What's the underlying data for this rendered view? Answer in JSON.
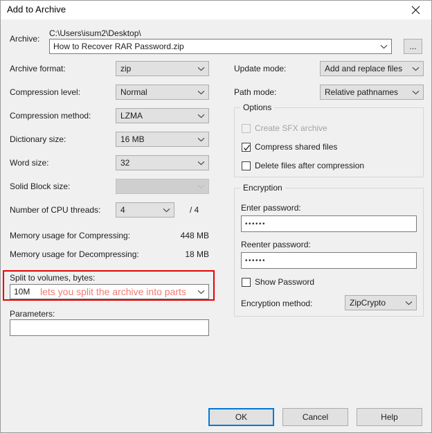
{
  "window": {
    "title": "Add to Archive",
    "close_icon": "close-icon"
  },
  "archive": {
    "label": "Archive:",
    "path_text": "C:\\Users\\isum2\\Desktop\\",
    "filename_value": "How to Recover RAR Password.zip",
    "browse_label": "..."
  },
  "left_column": {
    "rows": [
      {
        "label": "Archive format:",
        "value": "zip",
        "disabled": false
      },
      {
        "label": "Compression level:",
        "value": "Normal",
        "disabled": false
      },
      {
        "label": "Compression method:",
        "value": "LZMA",
        "disabled": false
      },
      {
        "label": "Dictionary size:",
        "value": "16 MB",
        "disabled": false
      },
      {
        "label": "Word size:",
        "value": "32",
        "disabled": false
      },
      {
        "label": "Solid Block size:",
        "value": "",
        "disabled": true
      }
    ],
    "cpu_threads": {
      "label": "Number of CPU threads:",
      "value": "4",
      "total": "/ 4"
    },
    "memory_compress": {
      "label": "Memory usage for Compressing:",
      "value": "448 MB"
    },
    "memory_decompress": {
      "label": "Memory usage for Decompressing:",
      "value": "18 MB"
    },
    "split": {
      "label": "Split to volumes, bytes:",
      "value": "10M"
    },
    "parameters": {
      "label": "Parameters:",
      "value": ""
    }
  },
  "annotation": {
    "text": "lets you split the archive into parts",
    "box_color": "#e60000",
    "text_color": "#ef7b72"
  },
  "right_column": {
    "update_mode": {
      "label": "Update mode:",
      "value": "Add and replace files"
    },
    "path_mode": {
      "label": "Path mode:",
      "value": "Relative pathnames"
    },
    "options": {
      "title": "Options",
      "items": [
        {
          "label": "Create SFX archive",
          "checked": false,
          "disabled": true
        },
        {
          "label": "Compress shared files",
          "checked": true,
          "disabled": false
        },
        {
          "label": "Delete files after compression",
          "checked": false,
          "disabled": false
        }
      ]
    },
    "encryption": {
      "title": "Encryption",
      "enter_password_label": "Enter password:",
      "enter_password_value": "••••••",
      "reenter_password_label": "Reenter password:",
      "reenter_password_value": "••••••",
      "show_password": {
        "label": "Show Password",
        "checked": false
      },
      "method_label": "Encryption method:",
      "method_value": "ZipCrypto"
    }
  },
  "footer": {
    "ok_label": "OK",
    "cancel_label": "Cancel",
    "help_label": "Help",
    "focus_color": "#0078d7"
  }
}
